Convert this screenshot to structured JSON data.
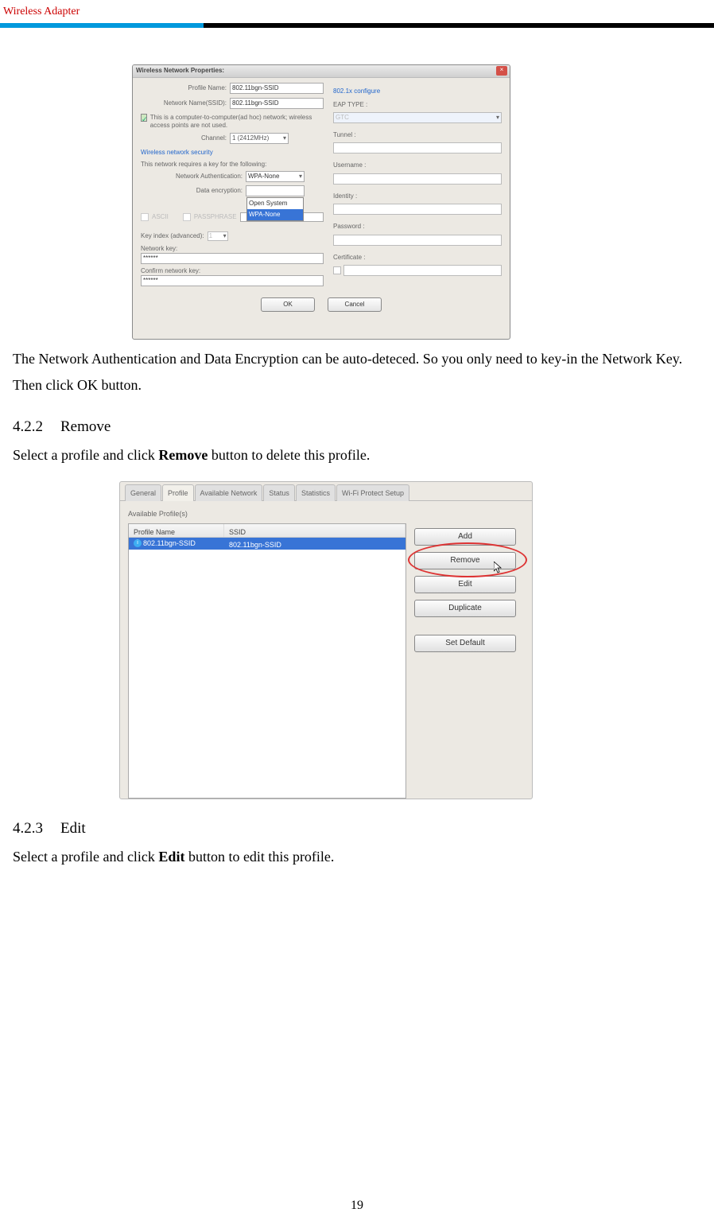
{
  "header": {
    "brand": "Wireless Adapter"
  },
  "page_number": "19",
  "para1": "The Network Authentication and Data Encryption can be auto-deteced. So you only need to key-in the Network Key. Then click OK button.",
  "heading422": {
    "num": "4.2.2",
    "title": "Remove"
  },
  "para2_pre": "Select a profile and click ",
  "para2_strong": "Remove",
  "para2_post": " button to delete this profile.",
  "heading423": {
    "num": "4.2.3",
    "title": "Edit"
  },
  "para3_pre": "Select a profile and click ",
  "para3_strong": "Edit",
  "para3_post": " button to edit this profile.",
  "dlg1": {
    "title": "Wireless Network Properties:",
    "profile_name_label": "Profile Name:",
    "profile_name_value": "802.11bgn-SSID",
    "ssid_label": "Network Name(SSID):",
    "ssid_value": "802.11bgn-SSID",
    "adhoc_text": "This is a computer-to-computer(ad hoc) network; wireless access points are not used.",
    "channel_label": "Channel:",
    "channel_value": "1  (2412MHz)",
    "wns_header": "Wireless network security",
    "wns_sub": "This network requires a key for the following:",
    "net_auth_label": "Network Authentication:",
    "net_auth_value": "WPA-None",
    "data_enc_label": "Data encryption:",
    "dd_open_system": "Open System",
    "dd_wpa_none": "WPA-None",
    "ascii_label": "ASCII",
    "pass_label": "PASSPHRASE",
    "key_index_label": "Key index (advanced):",
    "key_index_value": "1",
    "net_key_label": "Network key:",
    "net_key_value": "******",
    "confirm_key_label": "Confirm network key:",
    "confirm_key_value": "******",
    "ok": "OK",
    "cancel": "Cancel",
    "r_header": "802.1x configure",
    "r_eap": "EAP TYPE :",
    "r_eap_val": "GTC",
    "r_tunnel": "Tunnel :",
    "r_user": "Username :",
    "r_identity": "Identity :",
    "r_password": "Password :",
    "r_cert": "Certificate :"
  },
  "dlg2": {
    "tabs": [
      "General",
      "Profile",
      "Available Network",
      "Status",
      "Statistics",
      "Wi-Fi Protect Setup"
    ],
    "group": "Available Profile(s)",
    "col_profile": "Profile Name",
    "col_ssid": "SSID",
    "row_profile": "802.11bgn-SSID",
    "row_ssid": "802.11bgn-SSID",
    "btn_add": "Add",
    "btn_remove": "Remove",
    "btn_edit": "Edit",
    "btn_dup": "Duplicate",
    "btn_setdef": "Set Default"
  }
}
